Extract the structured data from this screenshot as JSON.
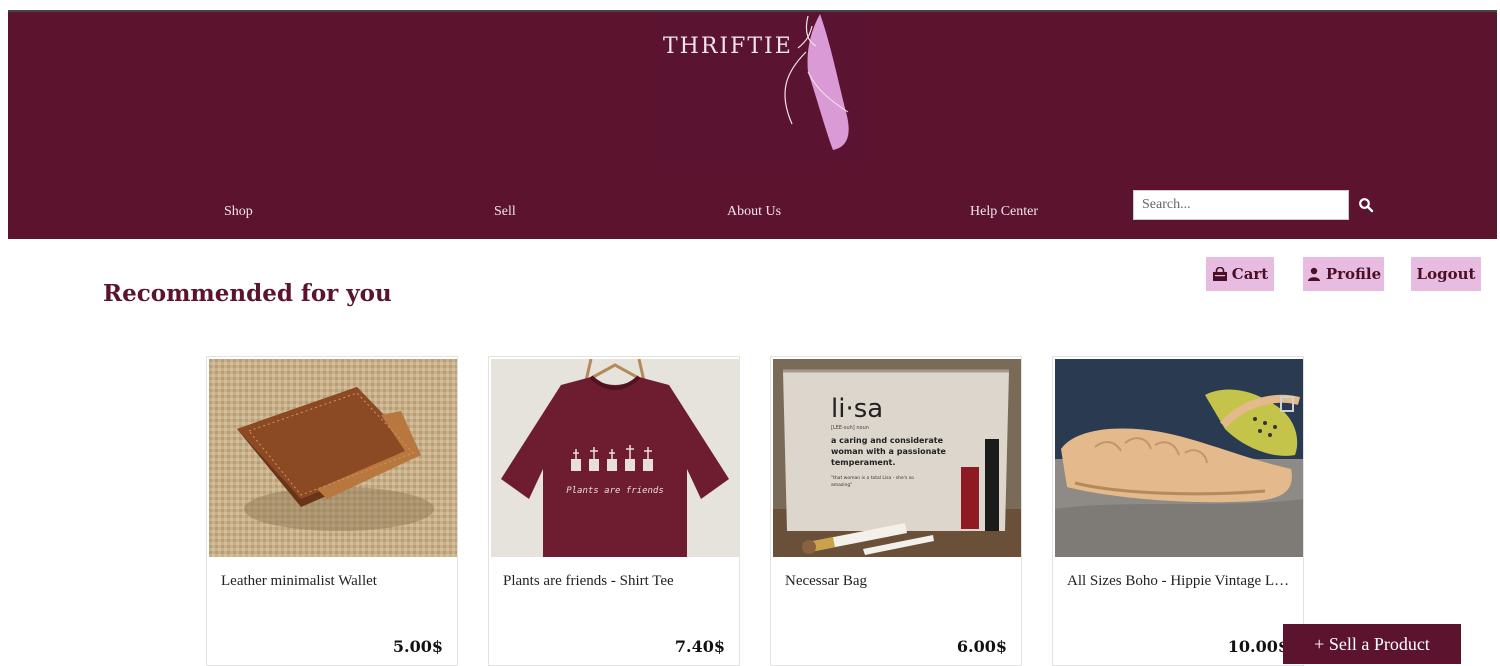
{
  "brand": {
    "logo_text": "THRIFTIE"
  },
  "nav": [
    {
      "label": "Shop"
    },
    {
      "label": "Sell"
    },
    {
      "label": "About Us"
    },
    {
      "label": "Help Center"
    }
  ],
  "search": {
    "placeholder": "Search...",
    "value": ""
  },
  "actions": {
    "cart": "Cart",
    "profile": "Profile",
    "logout": "Logout"
  },
  "section_title": "Recommended for you",
  "products": [
    {
      "name": "Leather minimalist Wallet",
      "price": "5.00$"
    },
    {
      "name": "Plants are friends - Shirt Tee",
      "price": "7.40$"
    },
    {
      "name": "Necessar Bag",
      "price": "6.00$"
    },
    {
      "name": "All Sizes Boho - Hippie Vintage Leather Sandals",
      "price": "10.00$"
    }
  ],
  "product_images": {
    "bag_word": "li·sa",
    "bag_phonetic": "[LEE-suh] noun",
    "bag_def": [
      "a caring and considerate",
      "woman with a passionate",
      "temperament."
    ],
    "bag_quote": [
      "\"that woman is a total Lisa - she's so",
      "amazing\""
    ],
    "tee_print": "Plants are friends"
  },
  "sell_button": "+ Sell a Product",
  "colors": {
    "brand": "#5c142e",
    "accent": "#e8bce0"
  }
}
